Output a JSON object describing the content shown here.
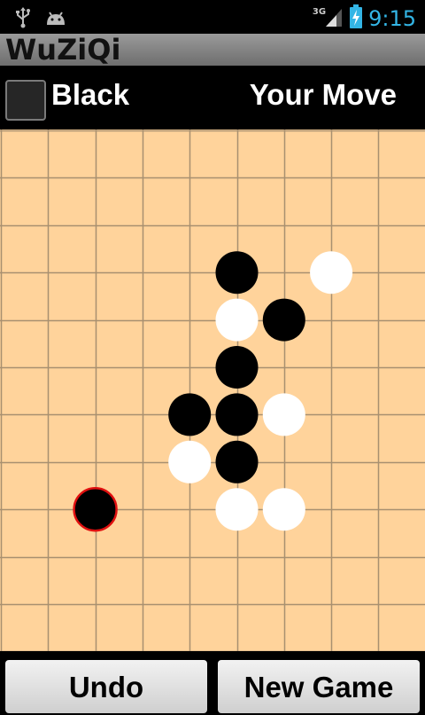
{
  "status_bar": {
    "time": "9:15",
    "network": "3G",
    "icons": [
      "usb-icon",
      "android-debug-icon",
      "signal-3g-icon",
      "battery-charging-icon"
    ]
  },
  "app": {
    "title": "WuZiQi"
  },
  "info": {
    "player": "Black",
    "status": "Your Move",
    "player_color": "#262626"
  },
  "board": {
    "columns": 9,
    "rows": 11,
    "background": "#ffd39b",
    "stones": [
      {
        "col": 4,
        "row": 2,
        "color": "black"
      },
      {
        "col": 6,
        "row": 2,
        "color": "white"
      },
      {
        "col": 4,
        "row": 3,
        "color": "white"
      },
      {
        "col": 5,
        "row": 3,
        "color": "black"
      },
      {
        "col": 4,
        "row": 4,
        "color": "black"
      },
      {
        "col": 3,
        "row": 5,
        "color": "black"
      },
      {
        "col": 4,
        "row": 5,
        "color": "black"
      },
      {
        "col": 5,
        "row": 5,
        "color": "white"
      },
      {
        "col": 3,
        "row": 6,
        "color": "white"
      },
      {
        "col": 4,
        "row": 6,
        "color": "black"
      },
      {
        "col": 1,
        "row": 7,
        "color": "black",
        "last_move": true
      },
      {
        "col": 4,
        "row": 7,
        "color": "white"
      },
      {
        "col": 5,
        "row": 7,
        "color": "white"
      }
    ]
  },
  "buttons": {
    "undo": "Undo",
    "new_game": "New Game"
  }
}
